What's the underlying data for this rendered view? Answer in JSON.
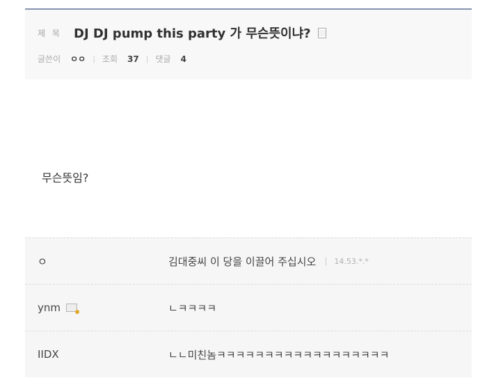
{
  "post": {
    "title_label": "제 목",
    "title": "DJ DJ pump this party 가 무슨뜻이냐?",
    "author_label": "글쓴이",
    "author": "ㅇㅇ",
    "views_label": "조회",
    "views": "37",
    "comments_label": "댓글",
    "comments_count": "4",
    "separator": "|",
    "body": "무슨뜻임?"
  },
  "comments": [
    {
      "author": "ㅇ",
      "text": "김대중씨 이 당을 이끌어 주십시오",
      "separator": "|",
      "ip": "14.53.*.*"
    },
    {
      "author": "ynm",
      "text": "ㄴㅋㅋㅋㅋ"
    },
    {
      "author": "IIDX",
      "text": "ㄴㄴ미친놈ㅋㅋㅋㅋㅋㅋㅋㅋㅋㅋㅋㅋㅋㅋㅋㅋㅋㅋ"
    }
  ]
}
